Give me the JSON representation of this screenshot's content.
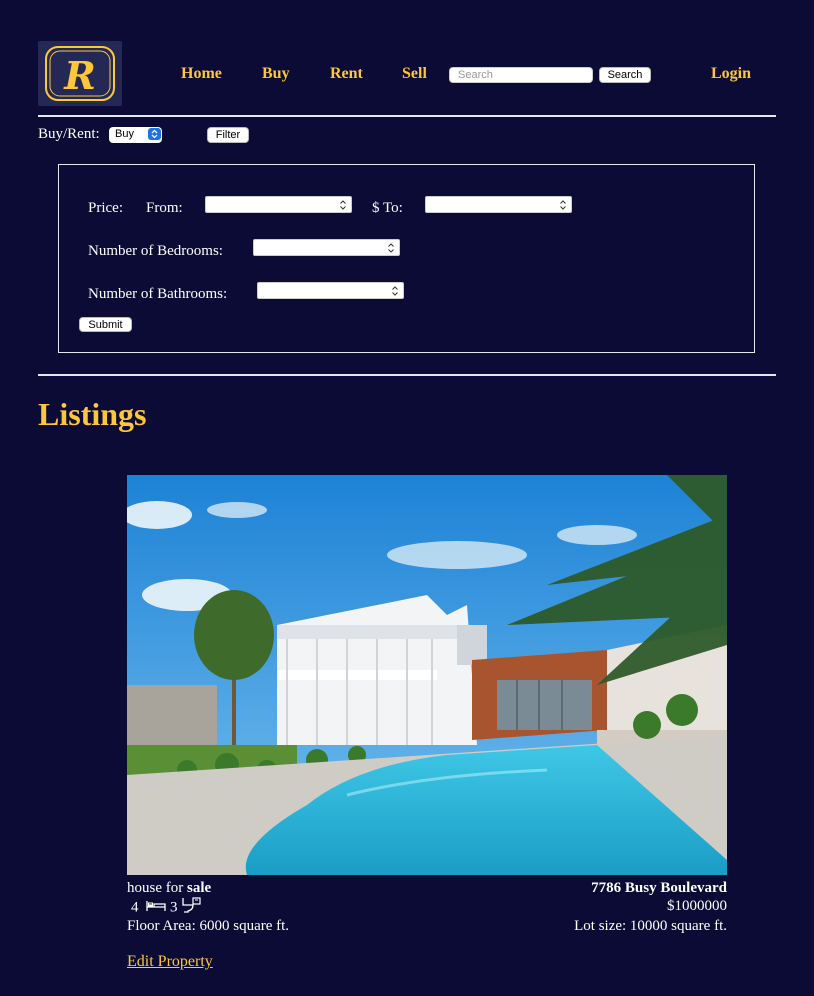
{
  "brand": {
    "logo_letter": "R",
    "gold": "#fcc73a",
    "background": "#0c0b36"
  },
  "nav": {
    "home": "Home",
    "buy": "Buy",
    "rent": "Rent",
    "sell": "Sell",
    "search_placeholder": "Search",
    "search_button": "Search",
    "login": "Login"
  },
  "filter": {
    "buy_rent_label": "Buy/Rent:",
    "buy_rent_selected": "Buy",
    "filter_button": "Filter"
  },
  "filter_panel": {
    "price_label": "Price:",
    "from_label": "From:",
    "to_label": "$ To:",
    "bedrooms_label": "Number of Bedrooms:",
    "bathrooms_label": "Number of Bathrooms:",
    "submit_button": "Submit"
  },
  "listings": {
    "heading": "Listings",
    "items": [
      {
        "type_prefix": "house for ",
        "status": "sale",
        "bedrooms": "4",
        "bathrooms": "3",
        "floor_area": "Floor Area: 6000 square ft.",
        "address": "7786 Busy Boulevard",
        "price": "$1000000",
        "lot_size": "Lot size: 10000 square ft.",
        "edit_link": "Edit Property",
        "bed_icon": "bed-icon",
        "bath_icon": "toilet-icon"
      }
    ]
  }
}
